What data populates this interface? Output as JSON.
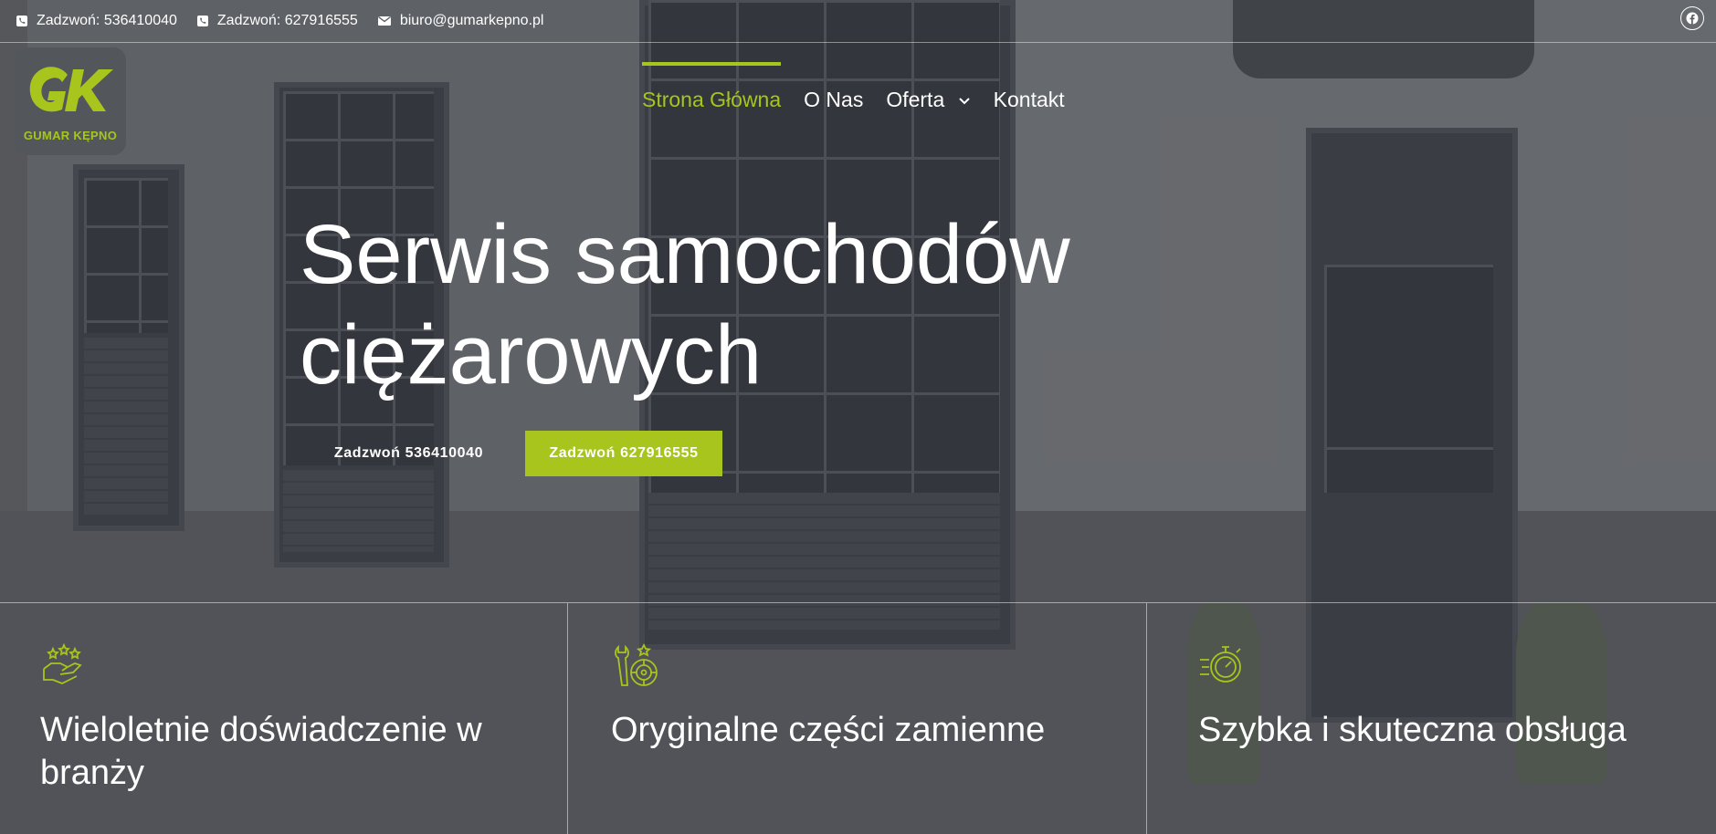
{
  "topbar": {
    "contacts": [
      {
        "icon": "phone-icon",
        "text": "Zadzwoń: 536410040"
      },
      {
        "icon": "phone-icon",
        "text": "Zadzwoń: 627916555"
      },
      {
        "icon": "envelope-icon",
        "text": "biuro@gumarkepno.pl"
      }
    ],
    "social_icon": "facebook-icon"
  },
  "logo": {
    "letters": "GK",
    "text": "GUMAR KĘPNO"
  },
  "nav": {
    "items": [
      {
        "label": "Strona Główna",
        "active": true
      },
      {
        "label": "O Nas",
        "active": false
      },
      {
        "label": "Oferta",
        "active": false,
        "has_dropdown": true
      },
      {
        "label": "Kontakt",
        "active": false
      }
    ]
  },
  "hero": {
    "title_line1": "Serwis samochodów",
    "title_line2": "ciężarowych",
    "buttons": [
      {
        "label": "Zadzwoń 536410040"
      },
      {
        "label": "Zadzwoń 627916555"
      }
    ]
  },
  "features": [
    {
      "icon": "hand-stars-icon",
      "title": "Wieloletnie doświadczenie w branży"
    },
    {
      "icon": "wrench-tire-icon",
      "title": "Oryginalne części zamienne"
    },
    {
      "icon": "fast-stopwatch-icon",
      "title": "Szybka i skuteczna obsługa"
    }
  ],
  "colors": {
    "accent": "#a7c51c",
    "text": "#ffffff"
  }
}
